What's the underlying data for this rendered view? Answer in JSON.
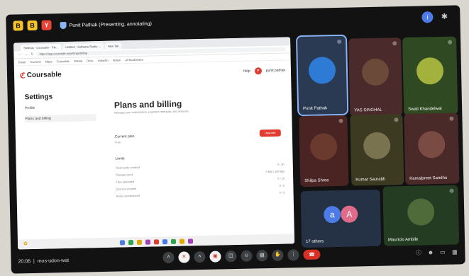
{
  "topbar": {
    "apps": [
      "B",
      "B",
      "Y"
    ],
    "presenting_text": "Punit Pathak (Presenting, annotating)"
  },
  "browser": {
    "tabs": [
      "Settings · Coursable · Ple...",
      "Untitled · Software Studio ...",
      "New Tab"
    ],
    "url": "https://app.coursable.io/settings/billing",
    "bookmarks": [
      "Gmail",
      "YouTube",
      "Maps",
      "Coursable",
      "GitHub",
      "Drive",
      "LinkedIn",
      "Notion",
      "All Bookmarks"
    ],
    "logo": "Coursable",
    "header_right": {
      "help": "Help",
      "user": "punit pathak"
    },
    "settings_title": "Settings",
    "side_items": [
      "Profile",
      "Plans and billing"
    ],
    "plans_title": "Plans and billing",
    "plans_sub": "Manage your subscription, payment methods, and invoices.",
    "current_plan_label": "Current plan",
    "current_plan_value": "Free",
    "upgrade_label": "Upgrade",
    "limits_label": "Limits",
    "limit_rows": [
      {
        "k": "Flashcards created",
        "v": "0 / 50"
      },
      {
        "k": "Storage used",
        "v": "0 MB / 100 MB"
      },
      {
        "k": "Files uploaded",
        "v": "0 / 10"
      },
      {
        "k": "Quizzes created",
        "v": "0 / 5"
      },
      {
        "k": "Notes summarized",
        "v": "0 / 5"
      }
    ]
  },
  "participants": [
    {
      "name": "Punit Pathak",
      "bg": "#2a3a52",
      "ava": "#2e7bd6"
    },
    {
      "name": "YAS SINGHAL",
      "bg": "#4a2a2a",
      "ava": "#6b4a3a"
    },
    {
      "name": "Swati Khandelwal",
      "bg": "#2f4a22",
      "ava": "#a3b13d"
    },
    {
      "name": "Shilpa Shree",
      "bg": "#4a2323",
      "ava": "#6a3a2e"
    },
    {
      "name": "Kumar Saurabh",
      "bg": "#3d3a22",
      "ava": "#7a7350"
    },
    {
      "name": "Kamalpreet Sandhu",
      "bg": "#4a2a28",
      "ava": "#7a4b43"
    },
    {
      "name": "17 others",
      "bg": "#253246",
      "others": [
        "a",
        "A"
      ]
    },
    {
      "name": "Mauricio Ambile",
      "bg": "#243d22",
      "ava": "#4f6b3a"
    }
  ],
  "bottombar": {
    "clock": "20:06",
    "meeting_code": "mos-udon-wat"
  },
  "icons": {
    "mic": "mic-off-icon",
    "cam": "camera-off-icon",
    "present": "present-icon",
    "raise": "raise-hand-icon",
    "more": "more-icon",
    "end": "end-call-icon"
  }
}
